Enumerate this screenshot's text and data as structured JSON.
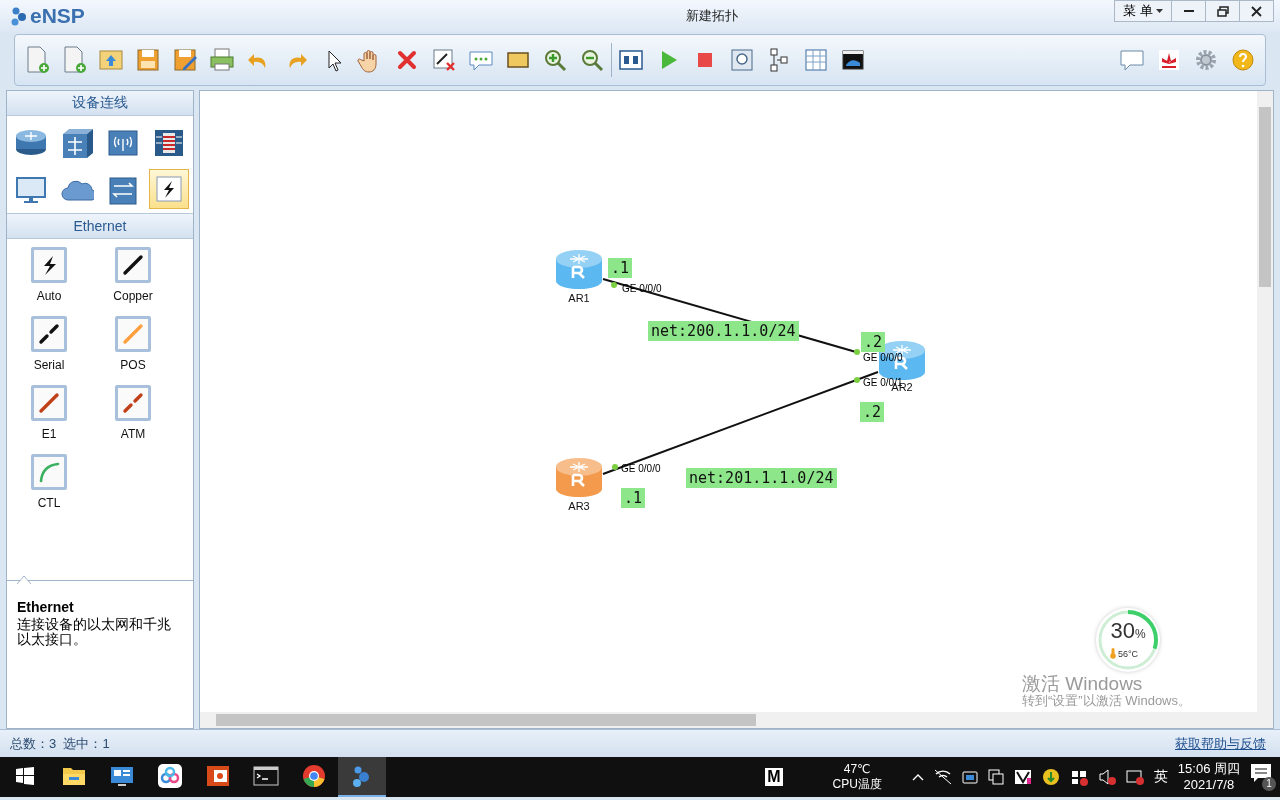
{
  "app": {
    "name": "eNSP"
  },
  "window": {
    "title": "新建拓扑",
    "menu": "菜 单"
  },
  "palette": {
    "title": "设备连线",
    "devices": [
      {
        "kind": "router",
        "selected": false
      },
      {
        "kind": "switch",
        "selected": false
      },
      {
        "kind": "wlan",
        "selected": false
      },
      {
        "kind": "firewall",
        "selected": false
      },
      {
        "kind": "pc",
        "selected": false
      },
      {
        "kind": "cloud",
        "selected": false
      },
      {
        "kind": "hub",
        "selected": false
      },
      {
        "kind": "cable",
        "selected": true
      }
    ]
  },
  "cable_panel": {
    "title": "Ethernet",
    "cables": [
      {
        "kind": "auto",
        "label": "Auto"
      },
      {
        "kind": "copper",
        "label": "Copper"
      },
      {
        "kind": "serial",
        "label": "Serial"
      },
      {
        "kind": "pos",
        "label": "POS"
      },
      {
        "kind": "e1",
        "label": "E1"
      },
      {
        "kind": "atm",
        "label": "ATM"
      },
      {
        "kind": "ctl",
        "label": "CTL"
      }
    ]
  },
  "description": {
    "title": "Ethernet",
    "text": "连接设备的以太网和千兆以太接口。"
  },
  "topology": {
    "nodes": [
      {
        "label": "AR1",
        "color": "#5cb8f0"
      },
      {
        "label": "AR2",
        "color": "#5cb8f0"
      },
      {
        "label": "AR3",
        "color": "#f39a4c"
      }
    ],
    "links": [
      {
        "from_port": "GE 0/0/0",
        "to_port": "GE 0/0/0"
      },
      {
        "from_port": "GE 0/0/0",
        "to_port": "GE 0/0/1"
      }
    ],
    "notes": [
      ".1",
      ".2",
      ".2",
      ".1",
      "net:200.1.1.0/24",
      "net:201.1.1.0/24"
    ]
  },
  "cpu_widget": {
    "value": "30",
    "unit": "%",
    "temperature": "56°C",
    "level": 0.3
  },
  "activation": {
    "title": "激活 Windows",
    "text": "转到“设置”以激活 Windows。"
  },
  "status_bar": {
    "summary": "总数：3  选中：1",
    "help_link": "获取帮助与反馈"
  },
  "taskbar": {
    "apps": [
      {
        "kind": "folder",
        "selected": false
      },
      {
        "kind": "monitor",
        "selected": false
      },
      {
        "kind": "cloud",
        "selected": false
      },
      {
        "kind": "slides",
        "selected": false
      },
      {
        "kind": "terminal",
        "selected": false
      },
      {
        "kind": "browser",
        "selected": false
      },
      {
        "kind": "ensp",
        "selected": true
      }
    ],
    "tray": {
      "app_letter": "M",
      "cpu_temp": "47℃",
      "cpu_label": "CPU温度",
      "ime": "英",
      "time": "15:06 周四",
      "date": "2021/7/8",
      "notifications": "1"
    }
  }
}
